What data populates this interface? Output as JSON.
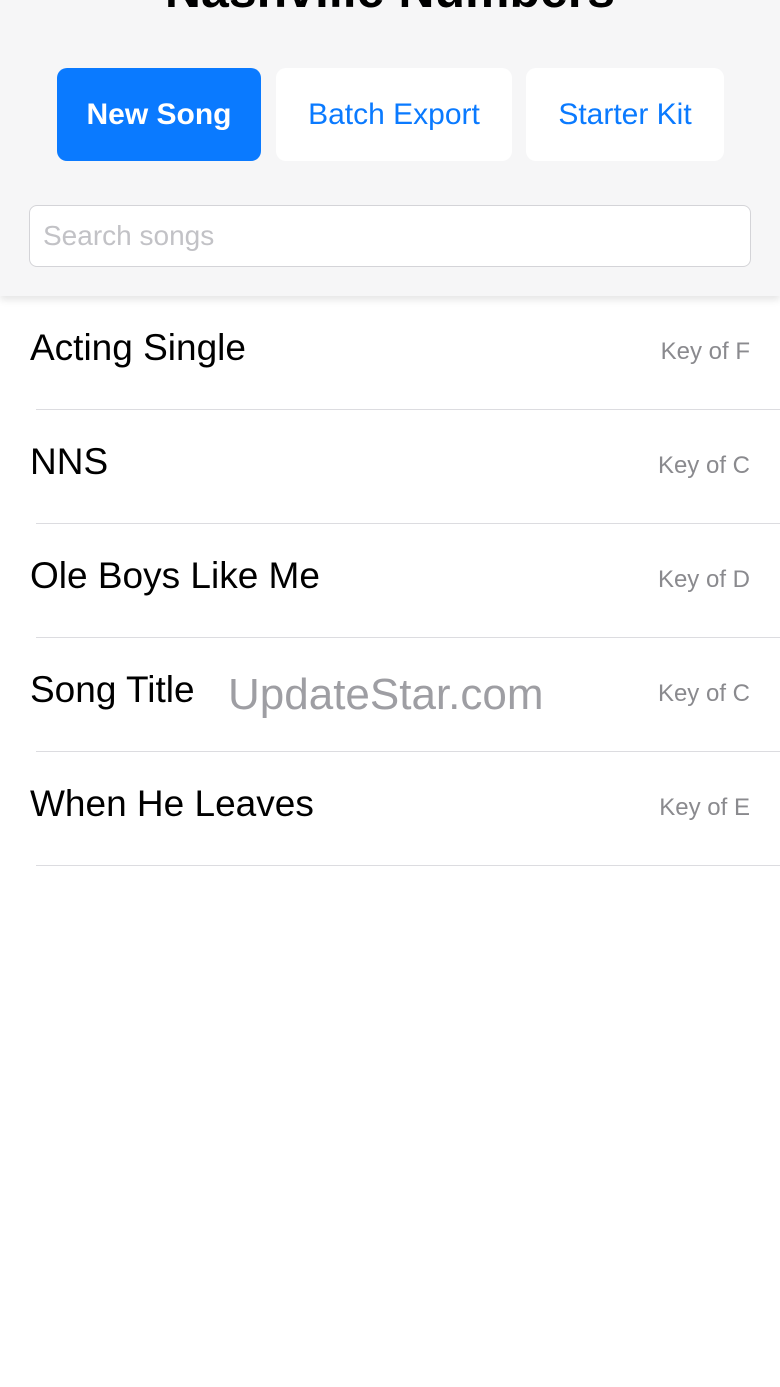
{
  "app": {
    "title": "Nashville Numbers"
  },
  "toolbar": {
    "new_song_label": "New Song",
    "batch_export_label": "Batch Export",
    "starter_kit_label": "Starter Kit"
  },
  "search": {
    "placeholder": "Search songs",
    "value": ""
  },
  "songs": [
    {
      "title": "Acting Single",
      "key": "Key of F"
    },
    {
      "title": "NNS",
      "key": "Key of C"
    },
    {
      "title": "Ole Boys Like Me",
      "key": "Key of D"
    },
    {
      "title": "Song Title",
      "key": "Key of C"
    },
    {
      "title": "When He Leaves",
      "key": "Key of E"
    }
  ],
  "watermark": {
    "text": "UpdateStar.com"
  },
  "colors": {
    "accent": "#0a7aff",
    "header_bg": "#f6f6f7",
    "secondary_text": "#8a8a8e"
  }
}
